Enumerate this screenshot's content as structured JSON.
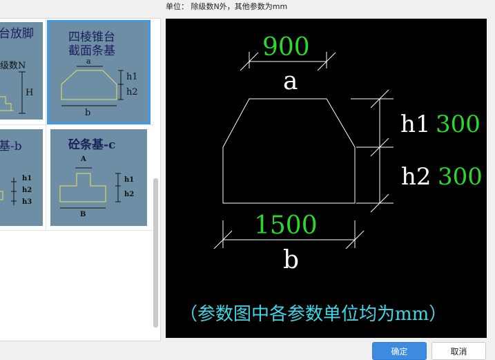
{
  "header": {
    "unit_note": "单位：  除级数N外，其他参数为mm"
  },
  "gallery": {
    "tile_top_left": {
      "title": "台放脚",
      "labels": [
        "级数N",
        "H"
      ]
    },
    "tile_selected": {
      "title_line1": "四棱锥台",
      "title_line2": "截面条基",
      "labels": [
        "a",
        "h1",
        "h2",
        "b"
      ]
    },
    "tile_bottom_left": {
      "title": "基-b",
      "labels": [
        "h1",
        "h2",
        "h3"
      ]
    },
    "tile_bottom_right": {
      "title": "砼条基-c",
      "labels": [
        "A",
        "h1",
        "h2",
        "B"
      ]
    }
  },
  "preview": {
    "params": [
      {
        "name": "a",
        "value": "900"
      },
      {
        "name": "h1",
        "value": "300"
      },
      {
        "name": "h2",
        "value": "300"
      },
      {
        "name": "b",
        "value": "1500"
      }
    ],
    "note": "（参数图中各参数单位均为mm）"
  },
  "buttons": {
    "ok": "确定",
    "cancel": "取消"
  },
  "colors": {
    "tile_bg": "#6d8ea4",
    "selected_outline": "#3d9be9",
    "value_green": "#2bd92b",
    "note_cyan": "#3fd6e6",
    "primary_button": "#3d8be0"
  }
}
